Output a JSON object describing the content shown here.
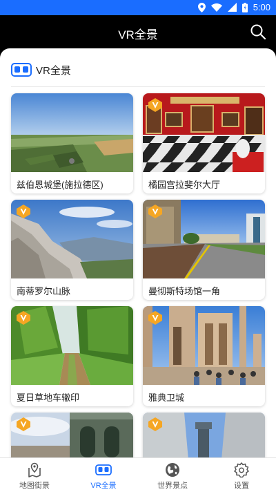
{
  "status_bar": {
    "time": "5:00",
    "icons": [
      "location-icon",
      "wifi-icon",
      "signal-icon",
      "battery-icon"
    ]
  },
  "header": {
    "title": "VR全景",
    "search_icon": "search-icon"
  },
  "section": {
    "title": "VR全景",
    "icon": "vr-headset-icon"
  },
  "cards": [
    {
      "label": "兹伯恩城堡(施拉德区)",
      "badge": false
    },
    {
      "label": "橘园宫拉斐尔大厅",
      "badge": true
    },
    {
      "label": "南蒂罗尔山脉",
      "badge": true
    },
    {
      "label": "曼彻斯特场馆一角",
      "badge": true
    },
    {
      "label": "夏日草地车辙印",
      "badge": true
    },
    {
      "label": "雅典卫城",
      "badge": true
    },
    {
      "label": "",
      "badge": true
    },
    {
      "label": "",
      "badge": true
    }
  ],
  "nav": [
    {
      "label": "地图街景",
      "icon": "map-pin-icon",
      "active": false
    },
    {
      "label": "VR全景",
      "icon": "vr-headset-icon",
      "active": true
    },
    {
      "label": "世界景点",
      "icon": "globe-icon",
      "active": false
    },
    {
      "label": "设置",
      "icon": "gear-icon",
      "active": false
    }
  ],
  "colors": {
    "accent": "#1a6dff",
    "badge": "#f5a623",
    "header_bg": "#000000"
  }
}
